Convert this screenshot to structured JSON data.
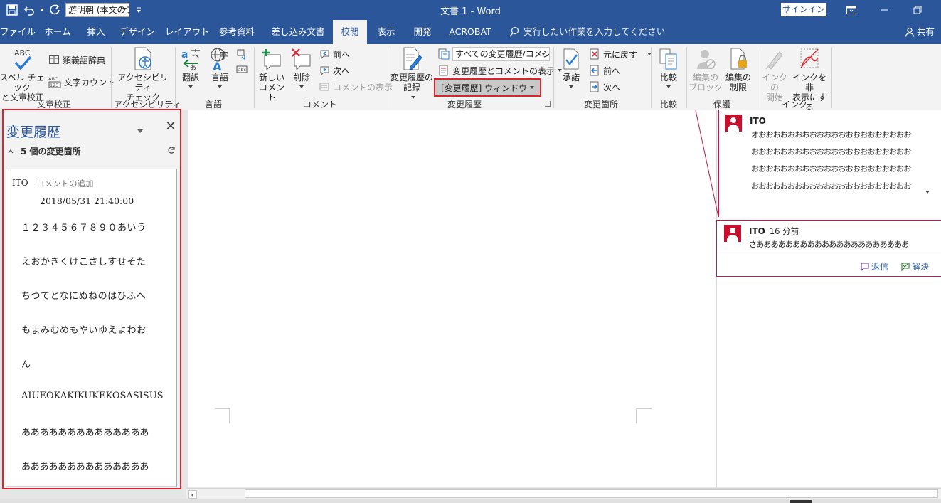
{
  "titlebar": {
    "doc_title": "文書 1  -  Word",
    "font_name": "游明朝 (本文のフォント)",
    "signin": "サインイン"
  },
  "tabs": [
    "ファイル",
    "ホーム",
    "挿入",
    "デザイン",
    "レイアウト",
    "参考資料",
    "差し込み文書",
    "校閲",
    "表示",
    "開発",
    "ACROBAT"
  ],
  "active_tab": "校閲",
  "tell_me": "実行したい作業を入力してください",
  "share": "共有",
  "ribbon": {
    "proofing": {
      "spell": [
        "スペル チェック",
        "と文章校正"
      ],
      "thesaurus": "類義語辞典",
      "wordcount": "文字カウント",
      "label": "文章校正"
    },
    "accessibility": {
      "check": [
        "アクセシビリティ",
        "チェック"
      ],
      "label": "アクセシビリティ"
    },
    "language": {
      "translate": "翻訳",
      "language": "言語",
      "label": "言語"
    },
    "comments": {
      "new": [
        "新しい",
        "コメント"
      ],
      "delete": "削除",
      "prev": "前へ",
      "next": "次へ",
      "show": "コメントの表示",
      "label": "コメント"
    },
    "tracking": {
      "track": [
        "変更履歴の",
        "記録"
      ],
      "markup_combo": "すべての変更履歴/コメント",
      "show_markup": "変更履歴とコメントの表示",
      "pane": "[変更履歴] ウィンドウ",
      "label": "変更履歴"
    },
    "changes": {
      "accept": "承諾",
      "reject": "元に戻す",
      "prev": "前へ",
      "next": "次へ",
      "label": "変更箇所"
    },
    "compare": {
      "compare": "比較",
      "label": "比較"
    },
    "protect": {
      "block": [
        "編集の",
        "ブロック"
      ],
      "restrict": [
        "編集の",
        "制限"
      ],
      "label": "保護"
    },
    "ink": {
      "start": [
        "インクの",
        "開始"
      ],
      "hide": [
        "インクを非",
        "表示にする"
      ],
      "label": "インク"
    }
  },
  "revisions_pane": {
    "title": "変更履歴",
    "summary": "5 個の変更箇所",
    "author": "ITO",
    "type": "コメントの追加",
    "date": "2018/05/31 21:40:00",
    "lines": [
      "１２３４５６７８９０あいう",
      "えおかきくけこさしすせそた",
      "ちつてとなにぬねのはひふへ",
      "もまみむめもやいゆえよわお",
      "ん",
      "AIUEOKAKIKUKEKOSASISUS",
      "ああああああああああああああ",
      "ああああああああああああああ"
    ]
  },
  "comments": [
    {
      "author": "ITO",
      "time": "",
      "lines": [
        "オおおおおおおおおおおおおおおおおおおおおお",
        "おおおおおおおおおおおおおおおおおおおおおお",
        "おおおおおおおおおおおおおおおおおおおおおお",
        "おおおおおおおおおおおおおおおおおおおおおお"
      ]
    },
    {
      "author": "ITO",
      "time": "16 分前",
      "lines": [
        "さあああああああああああああああああああああ"
      ],
      "reply": "返信",
      "resolve": "解決"
    }
  ],
  "colors": {
    "word_blue": "#2b579a",
    "highlight_red": "#d9262e",
    "comment_red": "#b91d47"
  }
}
